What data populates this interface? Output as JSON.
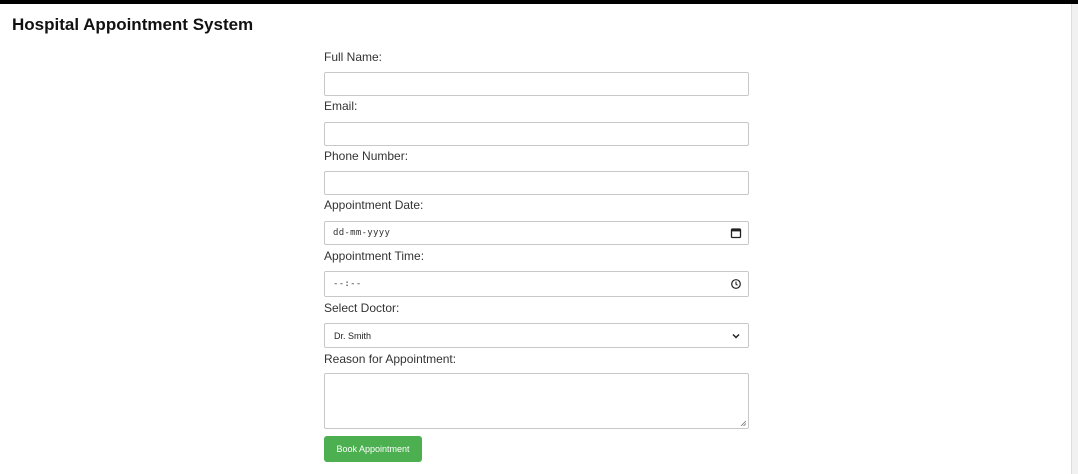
{
  "page": {
    "title": "Hospital Appointment System"
  },
  "form": {
    "full_name": {
      "label": "Full Name:",
      "value": ""
    },
    "email": {
      "label": "Email:",
      "value": ""
    },
    "phone": {
      "label": "Phone Number:",
      "value": ""
    },
    "date": {
      "label": "Appointment Date:",
      "placeholder": "dd-mm-yyyy",
      "icon": "calendar-icon"
    },
    "time": {
      "label": "Appointment Time:",
      "placeholder": "--:--",
      "icon": "clock-icon"
    },
    "doctor": {
      "label": "Select Doctor:",
      "selected": "Dr. Smith",
      "icon": "chevron-down-icon"
    },
    "reason": {
      "label": "Reason for Appointment:",
      "value": ""
    },
    "submit_label": "Book Appointment"
  },
  "colors": {
    "button": "#4caf50",
    "top_bar": "#000000"
  }
}
